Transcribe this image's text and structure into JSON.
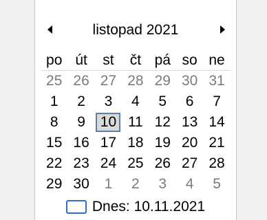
{
  "calendar": {
    "month_label": "listopad 2021",
    "weekdays": [
      "po",
      "út",
      "st",
      "čt",
      "pá",
      "so",
      "ne"
    ],
    "weeks": [
      [
        {
          "d": "25",
          "m": true
        },
        {
          "d": "26",
          "m": true
        },
        {
          "d": "27",
          "m": true
        },
        {
          "d": "28",
          "m": true
        },
        {
          "d": "29",
          "m": true
        },
        {
          "d": "30",
          "m": true
        },
        {
          "d": "31",
          "m": true
        }
      ],
      [
        {
          "d": "1"
        },
        {
          "d": "2"
        },
        {
          "d": "3"
        },
        {
          "d": "4"
        },
        {
          "d": "5"
        },
        {
          "d": "6"
        },
        {
          "d": "7"
        }
      ],
      [
        {
          "d": "8"
        },
        {
          "d": "9"
        },
        {
          "d": "10",
          "sel": true
        },
        {
          "d": "11"
        },
        {
          "d": "12"
        },
        {
          "d": "13"
        },
        {
          "d": "14"
        }
      ],
      [
        {
          "d": "15"
        },
        {
          "d": "16"
        },
        {
          "d": "17"
        },
        {
          "d": "18"
        },
        {
          "d": "19"
        },
        {
          "d": "20"
        },
        {
          "d": "21"
        }
      ],
      [
        {
          "d": "22"
        },
        {
          "d": "23"
        },
        {
          "d": "24"
        },
        {
          "d": "25"
        },
        {
          "d": "26"
        },
        {
          "d": "27"
        },
        {
          "d": "28"
        }
      ],
      [
        {
          "d": "29"
        },
        {
          "d": "30"
        },
        {
          "d": "1",
          "m": true
        },
        {
          "d": "2",
          "m": true
        },
        {
          "d": "3",
          "m": true
        },
        {
          "d": "4",
          "m": true
        },
        {
          "d": "5",
          "m": true
        }
      ]
    ],
    "today_label": "Dnes: 10.11.2021"
  },
  "icons": {
    "prev": "triangle-left-icon",
    "next": "triangle-right-icon"
  },
  "colors": {
    "selected_border": "#5d7fa3",
    "today_border": "#2b6cd8",
    "muted_text": "#7a7a7a"
  }
}
